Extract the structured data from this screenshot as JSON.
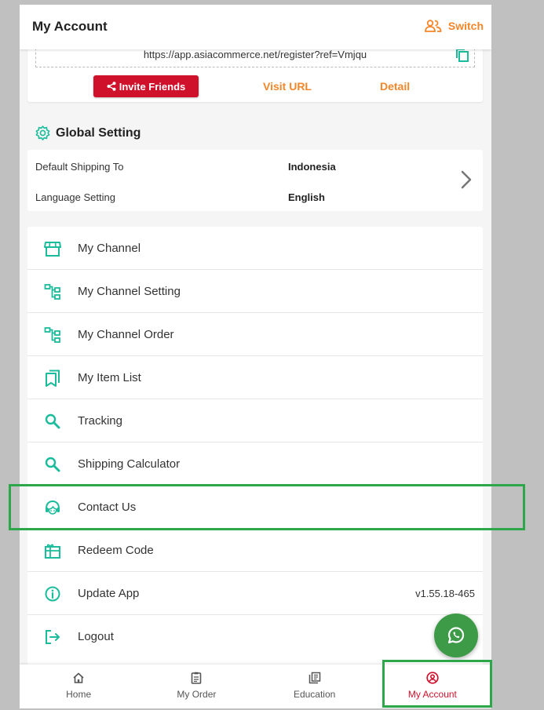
{
  "header": {
    "title": "My Account",
    "switch_label": "Switch"
  },
  "invite": {
    "url": "https://app.asiacommerce.net/register?ref=Vmjqu",
    "invite_label": "Invite Friends",
    "visit_label": "Visit URL",
    "detail_label": "Detail"
  },
  "global_setting": {
    "title": "Global Setting",
    "rows": [
      {
        "label": "Default Shipping To",
        "value": "Indonesia"
      },
      {
        "label": "Language Setting",
        "value": "English"
      }
    ]
  },
  "menu": [
    {
      "label": "My Channel",
      "icon": "store-icon"
    },
    {
      "label": "My Channel Setting",
      "icon": "sitemap-icon"
    },
    {
      "label": "My Channel Order",
      "icon": "sitemap-icon"
    },
    {
      "label": "My Item List",
      "icon": "bookmarks-icon"
    },
    {
      "label": "Tracking",
      "icon": "search-icon"
    },
    {
      "label": "Shipping Calculator",
      "icon": "search-icon"
    },
    {
      "label": "Contact Us",
      "icon": "support-agent-icon"
    },
    {
      "label": "Redeem Code",
      "icon": "gift-card-icon"
    },
    {
      "label": "Update App",
      "icon": "info-icon",
      "right": "v1.55.18-465"
    },
    {
      "label": "Logout",
      "icon": "logout-icon"
    }
  ],
  "bottom_nav": [
    {
      "label": "Home",
      "icon": "home-icon"
    },
    {
      "label": "My Order",
      "icon": "order-icon"
    },
    {
      "label": "Education",
      "icon": "education-icon"
    },
    {
      "label": "My Account",
      "icon": "account-icon",
      "active": true
    }
  ],
  "colors": {
    "accent_orange": "#f5862a",
    "brand_red": "#d0112b",
    "teal": "#1bbc9b",
    "whatsapp_green": "#3d9a47",
    "highlight": "#2ca84a"
  }
}
